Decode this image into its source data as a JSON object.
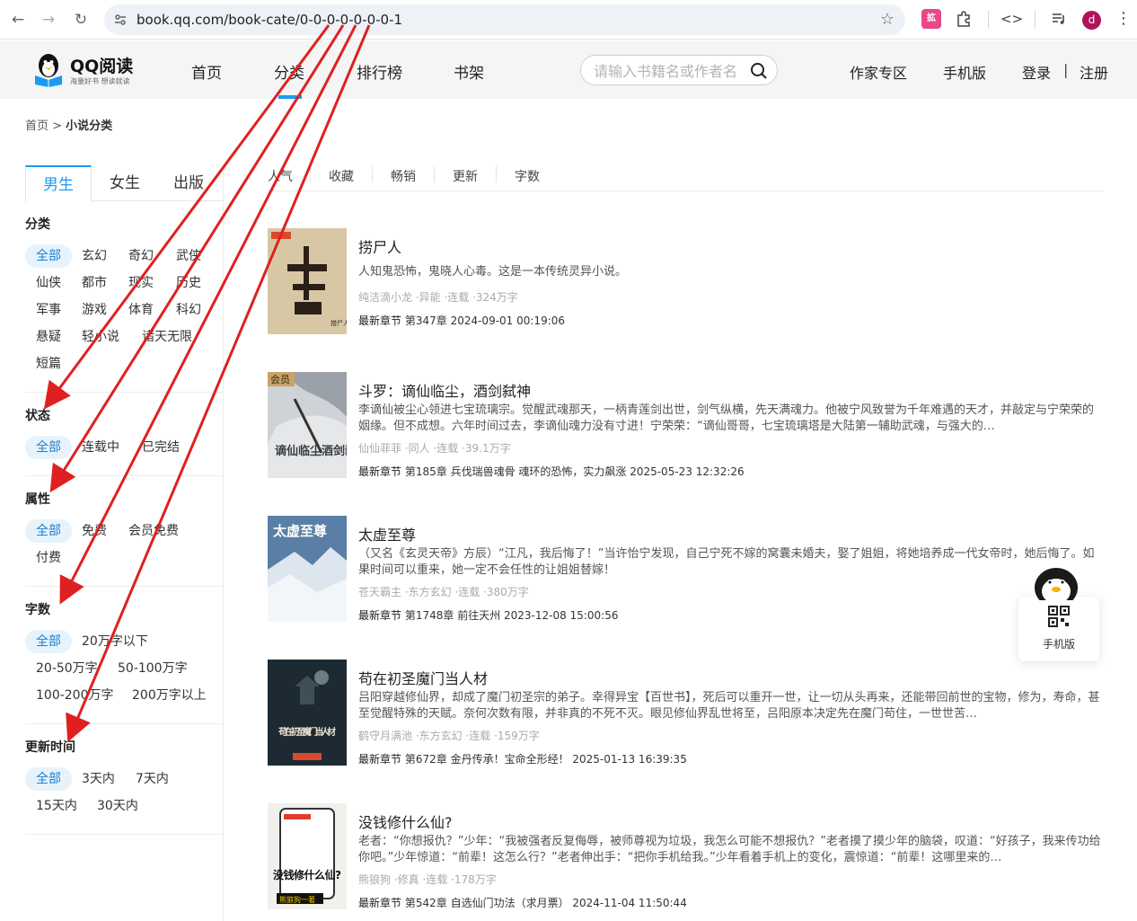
{
  "browser": {
    "url": "book.qq.com/book-cate/0-0-0-0-0-0-0-1",
    "avatar_letter": "d",
    "ext_label": "拡"
  },
  "site": {
    "logo_text": "QQ阅读",
    "logo_sub": "海量好书  想读就读",
    "nav": [
      "首页",
      "分类",
      "排行榜",
      "书架"
    ],
    "search_placeholder": "请输入书籍名或作者名",
    "links": {
      "author": "作家专区",
      "mobile": "手机版",
      "login": "登录",
      "sep": "|",
      "register": "注册"
    }
  },
  "breadcrumb": {
    "home": "首页 >",
    "current": "小说分类"
  },
  "sidebar": {
    "gender_tabs": [
      "男生",
      "女生",
      "出版"
    ],
    "sections": {
      "category": {
        "title": "分类",
        "items": [
          "全部",
          "玄幻",
          "奇幻",
          "武侠",
          "仙侠",
          "都市",
          "现实",
          "历史",
          "军事",
          "游戏",
          "体育",
          "科幻",
          "悬疑",
          "轻小说",
          "诸天无限",
          "短篇"
        ]
      },
      "status": {
        "title": "状态",
        "items": [
          "全部",
          "连载中",
          "已完结"
        ]
      },
      "attribute": {
        "title": "属性",
        "items": [
          "全部",
          "免费",
          "会员免费",
          "付费"
        ]
      },
      "words": {
        "title": "字数",
        "items": [
          "全部",
          "20万字以下",
          "20-50万字",
          "50-100万字",
          "100-200万字",
          "200万字以上"
        ]
      },
      "update": {
        "title": "更新时间",
        "items": [
          "全部",
          "3天内",
          "7天内",
          "15天内",
          "30天内"
        ]
      }
    }
  },
  "sort_tabs": [
    "人气",
    "收藏",
    "畅销",
    "更新",
    "字数"
  ],
  "books": [
    {
      "title": "捞尸人",
      "desc": "人知鬼恐怖，鬼晓人心毒。这是一本传统灵异小说。",
      "meta": "纯洁滴小龙 ·异能 ·连载 ·324万字",
      "chapter_label": "最新章节",
      "chapter": "第347章 2024-09-01 00:19:06"
    },
    {
      "title": "斗罗：谪仙临尘，酒剑弑神",
      "desc": "李谪仙被尘心领进七宝琉璃宗。觉醒武魂那天，一柄青莲剑出世，剑气纵横，先天满魂力。他被宁风致誉为千年难遇的天才，并敲定与宁荣荣的姻缘。但不成想。六年时间过去，李谪仙魂力没有寸进！宁荣荣：“谪仙哥哥，七宝琉璃塔是大陆第一辅助武魂，与强大的…",
      "meta": "仙仙菲菲 ·同人 ·连载 ·39.1万字",
      "chapter_label": "最新章节",
      "chapter": "第185章 兵伐瑞兽魂骨 魂环的恐怖，实力飙涨 2025-05-23 12:32:26",
      "badge": "会员"
    },
    {
      "title": "太虚至尊",
      "desc": "（又名《玄灵天帝》方辰）“江凡，我后悔了！”当许怡宁发现，自己宁死不嫁的窝囊未婚夫，娶了姐姐，将她培养成一代女帝时，她后悔了。如果时间可以重来，她一定不会任性的让姐姐替嫁！",
      "meta": "苍天霸主 ·东方玄幻 ·连载 ·380万字",
      "chapter_label": "最新章节",
      "chapter": "第1748章 前往天州 2023-12-08 15:00:56"
    },
    {
      "title": "苟在初圣魔门当人材",
      "desc": "吕阳穿越修仙界，却成了魔门初圣宗的弟子。幸得异宝【百世书】，死后可以重开一世，让一切从头再来，还能带回前世的宝物，修为，寿命，甚至觉醒特殊的天赋。奈何次数有限，并非真的不死不灭。眼见修仙界乱世将至，吕阳原本决定先在魔门苟住，一世世苦…",
      "meta": "鹤守月满池 ·东方玄幻 ·连载 ·159万字",
      "chapter_label": "最新章节",
      "chapter": "第672章 金丹传承！宝命全形经！ 2025-01-13 16:39:35"
    },
    {
      "title": "没钱修什么仙?",
      "desc": "老者：“你想报仇？”少年：“我被强者反复侮辱，被师尊视为垃圾，我怎么可能不想报仇？”老者摸了摸少年的脑袋，叹道：“好孩子，我来传功给你吧。”少年惊道：“前辈！这怎么行？”老者伸出手：“把你手机给我。”少年看着手机上的变化，震惊道：“前辈！这哪里来的…",
      "meta": "熊狼狗 ·修真 ·连载 ·178万字",
      "chapter_label": "最新章节",
      "chapter": "第542章 自选仙门功法（求月票） 2024-11-04 11:50:44"
    }
  ],
  "covers": {
    "c1": {
      "text": "捞尸人"
    },
    "c2": {
      "text": "谪仙临尘酒剑弑神"
    },
    "c3": {
      "text": "太虚至尊"
    },
    "c4": {
      "text": "苟在初圣魔门当人材"
    },
    "c5": {
      "text": "没钱修什么仙?",
      "by": "熊狼狗一著"
    }
  },
  "float": {
    "label": "手机版"
  },
  "colors": {
    "accent": "#1a9bf0",
    "arrow": "#e02020"
  }
}
